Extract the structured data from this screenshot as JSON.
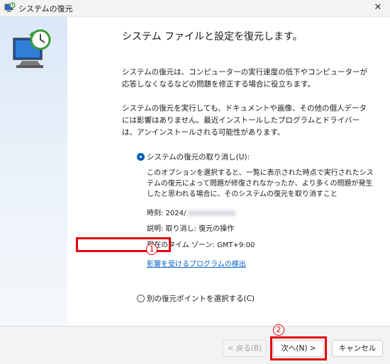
{
  "window": {
    "title": "システムの復元",
    "close_icon": "close-icon"
  },
  "main": {
    "heading": "システム ファイルと設定を復元します。",
    "paragraph1": "システムの復元は、コンピューターの実行速度の低下やコンピューターが応答しなくなるなどの問題を修正する場合に役立ちます。",
    "paragraph2": "システムの復元を実行しても、ドキュメントや画像、その他の個人データには影響はありません。最近インストールしたプログラムとドライバーは、アンインストールされる可能性があります。",
    "option_undo": {
      "label": "システムの復元の取り消し(U):",
      "selected": true,
      "description": "このオプションを選択すると、一覧に表示された時点で実行されたシステムの復元によって問題が修復されなかったか、より多くの問題が発生したと思われる場合に、そのシステムの復元を取り消すこと",
      "time": "時刻: 2024/",
      "explanation": "説明: 取り消し: 復元の操作",
      "timezone": "現在のタイム ゾーン: GMT+9:00",
      "scan_link": "影響を受けるプログラムの検出"
    },
    "option_other": {
      "label": "別の復元ポイントを選択する(C)",
      "selected": false
    }
  },
  "annotations": {
    "marker1": "1",
    "marker2": "2",
    "color": "#e5000f"
  },
  "footer": {
    "back_label": "< 戻る(B)",
    "next_label": "次へ(N) >",
    "cancel_label": "キャンセル"
  },
  "colors": {
    "accent": "#005fb8",
    "link": "#0b63c3"
  }
}
